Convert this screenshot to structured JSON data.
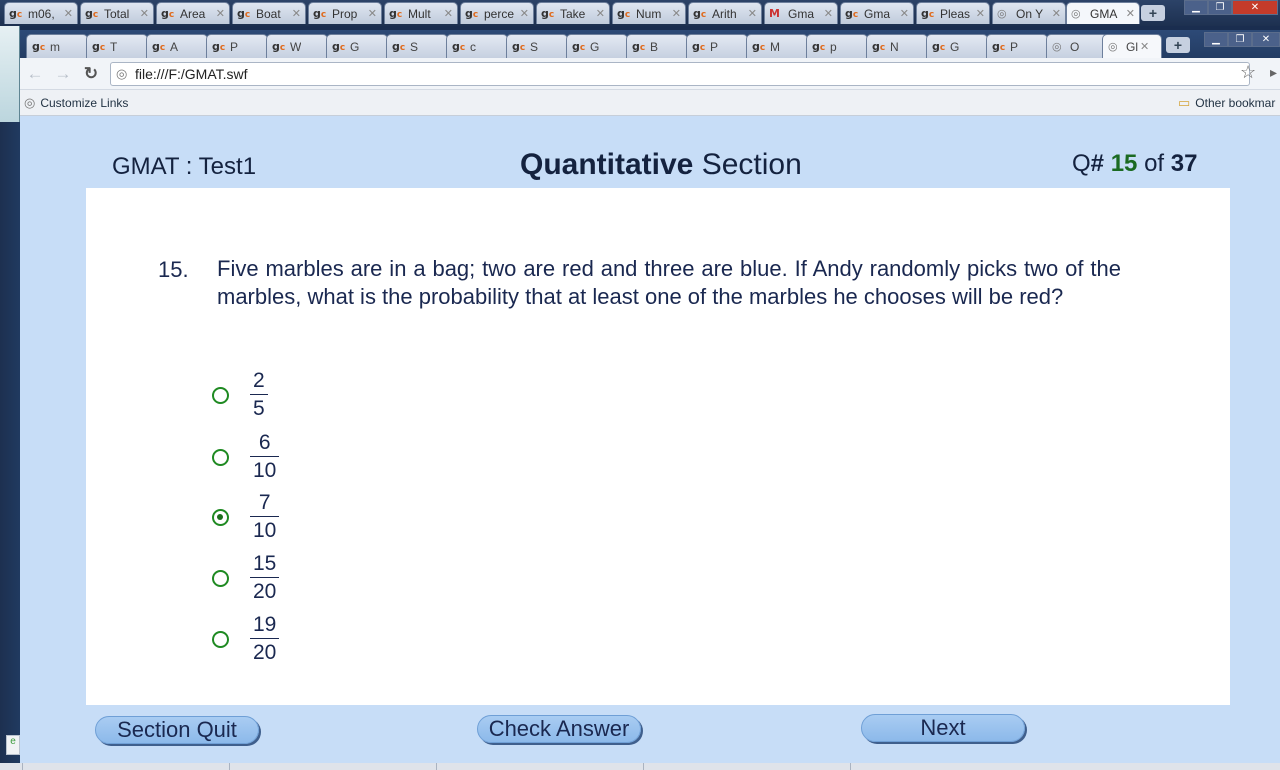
{
  "outer_tabs": [
    {
      "icon": "gc",
      "label": "m06,"
    },
    {
      "icon": "gc",
      "label": "Total"
    },
    {
      "icon": "gc",
      "label": "Area"
    },
    {
      "icon": "gc",
      "label": "Boat"
    },
    {
      "icon": "gc",
      "label": "Prop"
    },
    {
      "icon": "gc",
      "label": "Mult"
    },
    {
      "icon": "gc",
      "label": "perce"
    },
    {
      "icon": "gc",
      "label": "Take"
    },
    {
      "icon": "gc",
      "label": "Num"
    },
    {
      "icon": "gc",
      "label": "Arith"
    },
    {
      "icon": "gmail",
      "label": "Gma"
    },
    {
      "icon": "gc",
      "label": "Gma"
    },
    {
      "icon": "gc",
      "label": "Pleas"
    },
    {
      "icon": "globe",
      "label": "On Y"
    },
    {
      "icon": "globe",
      "label": "GMA"
    }
  ],
  "inner_tabs": [
    {
      "icon": "gc",
      "label": "m"
    },
    {
      "icon": "gc",
      "label": "T"
    },
    {
      "icon": "gc",
      "label": "A"
    },
    {
      "icon": "gc",
      "label": "P"
    },
    {
      "icon": "gc",
      "label": "W"
    },
    {
      "icon": "gc",
      "label": "G"
    },
    {
      "icon": "gc",
      "label": "S"
    },
    {
      "icon": "gc",
      "label": "c"
    },
    {
      "icon": "gc",
      "label": "S"
    },
    {
      "icon": "gc",
      "label": "G"
    },
    {
      "icon": "gc",
      "label": "B"
    },
    {
      "icon": "gc",
      "label": "P"
    },
    {
      "icon": "gc",
      "label": "M"
    },
    {
      "icon": "gc",
      "label": "p"
    },
    {
      "icon": "gc",
      "label": "N"
    },
    {
      "icon": "gc",
      "label": "G"
    },
    {
      "icon": "gc",
      "label": "P"
    },
    {
      "icon": "globe",
      "label": "O"
    },
    {
      "icon": "globe",
      "label": "Gl"
    }
  ],
  "address_bar": {
    "url": "file:///F:/GMAT.swf"
  },
  "bookmarks": {
    "left": "Customize Links",
    "right": "Other bookmar"
  },
  "header": {
    "test_name": "GMAT : Test1",
    "section_bold": "Quantitative",
    "section_rest": " Section",
    "counter_prefix": "Q",
    "counter_hash": "#",
    "current": "15",
    "of_label": "of",
    "total": "37"
  },
  "question": {
    "number": "15.",
    "text": "Five marbles are in a bag; two are red and three are blue. If Andy randomly picks two of the marbles, what is the probability that at least one of the marbles he chooses will be red?"
  },
  "options": [
    {
      "numerator": "2",
      "denominator": "5",
      "selected": false
    },
    {
      "numerator": "6",
      "denominator": "10",
      "selected": false
    },
    {
      "numerator": "7",
      "denominator": "10",
      "selected": true
    },
    {
      "numerator": "15",
      "denominator": "20",
      "selected": false
    },
    {
      "numerator": "19",
      "denominator": "20",
      "selected": false
    }
  ],
  "buttons": {
    "quit": "Section Quit",
    "check": "Check Answer",
    "next": "Next"
  },
  "colors": {
    "page_bg": "#c7ddf7",
    "text": "#1a2850",
    "radio_green": "#1f8a22",
    "counter_green": "#1b6a22",
    "button_blue": "#9dc4ef"
  }
}
